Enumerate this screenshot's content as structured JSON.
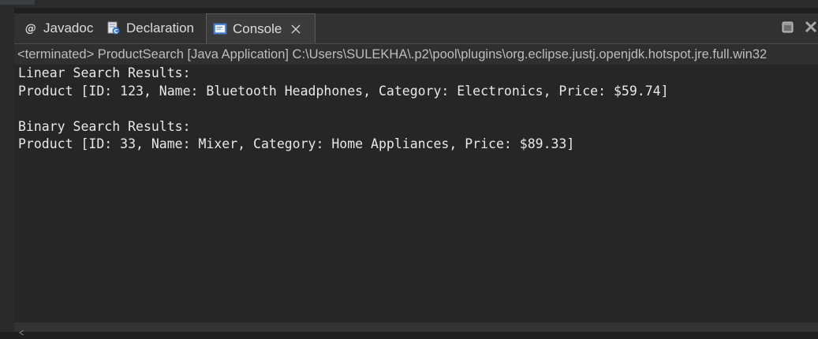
{
  "tabs": [
    {
      "label": "Javadoc",
      "icon": "at-sign-icon",
      "active": false
    },
    {
      "label": "Declaration",
      "icon": "declaration-icon",
      "active": false
    },
    {
      "label": "Console",
      "icon": "console-icon",
      "active": true
    }
  ],
  "status": "<terminated> ProductSearch [Java Application] C:\\Users\\SULEKHA\\.p2\\pool\\plugins\\org.eclipse.justj.openjdk.hotspot.jre.full.win32",
  "console_lines": [
    "Linear Search Results:",
    "Product [ID: 123, Name: Bluetooth Headphones, Category: Electronics, Price: $59.74]",
    "",
    "Binary Search Results:",
    "Product [ID: 33, Name: Mixer, Category: Home Appliances, Price: $89.33]"
  ],
  "colors": {
    "background": "#1f1f1f",
    "console_bg": "#262626",
    "text": "#e8e8e8",
    "tab_icon_blue": "#5b8fd6"
  }
}
